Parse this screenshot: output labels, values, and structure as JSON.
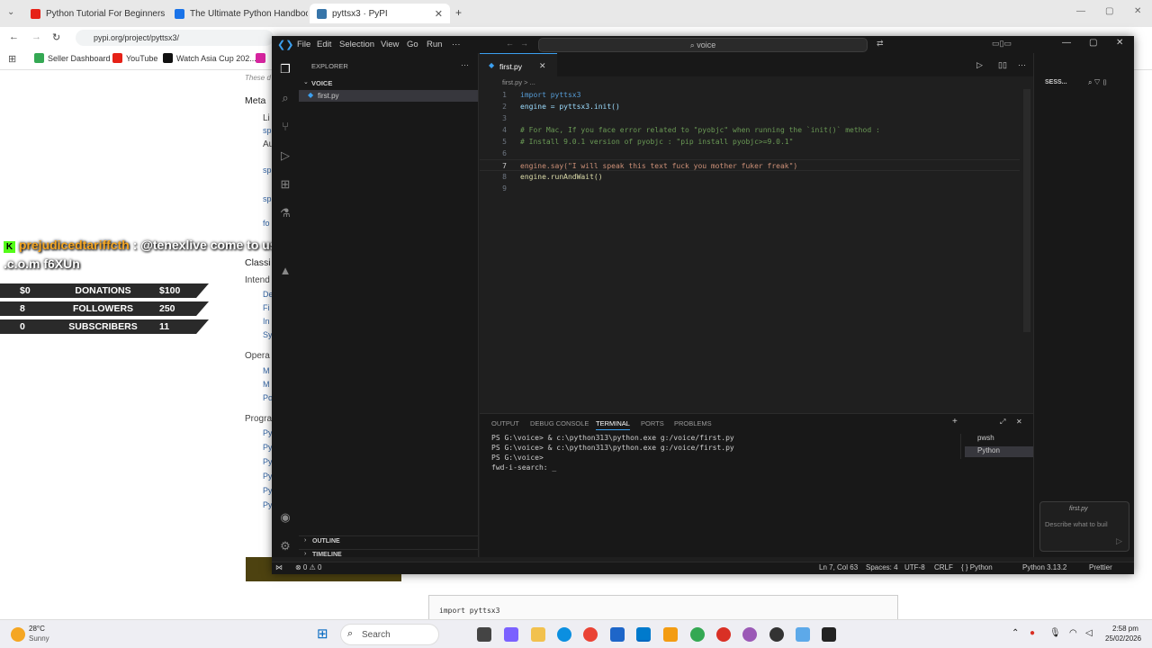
{
  "browser": {
    "tabs": [
      {
        "title": "Python Tutorial For Beginners i..."
      },
      {
        "title": "The Ultimate Python Handbook"
      },
      {
        "title": "pyttsx3 · PyPI"
      }
    ],
    "url": "pypi.org/project/pyttsx3/",
    "bookmarks": [
      "Seller Dashboard",
      "YouTube",
      "Watch Asia Cup 202..."
    ]
  },
  "pypi": {
    "faded": "These d",
    "meta_heading": "Meta",
    "meta_item": "Li",
    "meta_item2": "Au",
    "classifiers_heading": "Classi",
    "intended": "Intend",
    "operating": "Opera",
    "programming": "Progra",
    "links": [
      "sp",
      "sp",
      "sp",
      "fo",
      "De",
      "Fi",
      "In",
      "Sy",
      "M",
      "M",
      "Po",
      "Py",
      "Py",
      "Py",
      "Py",
      "Py",
      "Py"
    ],
    "snippet": "import pyttsx3"
  },
  "overlay": {
    "user": "prejudicedtariffcth",
    "message": ": @tenexlive come to us - n.e.z.h.n.a",
    "message2": ".c.o.m f6XUn",
    "stats": [
      {
        "left": "$0",
        "label": "DONATIONS",
        "right": "$100"
      },
      {
        "left": "8",
        "label": "FOLLOWERS",
        "right": "250"
      },
      {
        "left": "0",
        "label": "SUBSCRIBERS",
        "right": "11"
      }
    ]
  },
  "vscode": {
    "menu": [
      "File",
      "Edit",
      "Selection",
      "View",
      "Go",
      "Run",
      "···"
    ],
    "command_center": "voice",
    "sidebar": {
      "title": "EXPLORER",
      "folder": "VOICE",
      "file": "first.py",
      "outline": "OUTLINE",
      "timeline": "TIMELINE"
    },
    "tab": "first.py",
    "breadcrumb": "first.py  >  ...",
    "code": [
      {
        "n": "1",
        "t": "import pyttsx3"
      },
      {
        "n": "2",
        "t": "engine = pyttsx3.init()"
      },
      {
        "n": "3",
        "t": ""
      },
      {
        "n": "4",
        "t": "# For Mac, If you face error related to \"pyobjc\" when running the `init()` method :"
      },
      {
        "n": "5",
        "t": "# Install 9.0.1 version of pyobjc : \"pip install pyobjc>=9.0.1\""
      },
      {
        "n": "6",
        "t": ""
      },
      {
        "n": "7",
        "t": "engine.say(\"I will speak this text fuck you mother fuker freak\")"
      },
      {
        "n": "8",
        "t": "engine.runAndWait()"
      },
      {
        "n": "9",
        "t": ""
      }
    ],
    "panel_tabs": [
      "OUTPUT",
      "DEBUG CONSOLE",
      "TERMINAL",
      "PORTS",
      "PROBLEMS"
    ],
    "terminal": [
      "PS G:\\voice> & c:\\python313\\python.exe g:/voice/first.py",
      "PS G:\\voice> & c:\\python313\\python.exe g:/voice/first.py",
      "PS G:\\voice> ",
      "fwd-i-search: _"
    ],
    "terminals": [
      "pwsh",
      "Python"
    ],
    "chat": {
      "file": "first.py",
      "placeholder": "Describe what to buil",
      "sessions": "SESS..."
    },
    "status": {
      "errors": "⊗ 0 ⚠ 0",
      "position": "Ln 7, Col 63",
      "spaces": "Spaces: 4",
      "encoding": "UTF-8",
      "eol": "CRLF",
      "lang": "{ } Python",
      "interp": "Python 3.13.2",
      "prettier": "Prettier"
    }
  },
  "taskbar": {
    "temp": "28°C",
    "weather": "Sunny",
    "search": "Search",
    "time": "2:58 pm",
    "date": "25/02/2026"
  }
}
